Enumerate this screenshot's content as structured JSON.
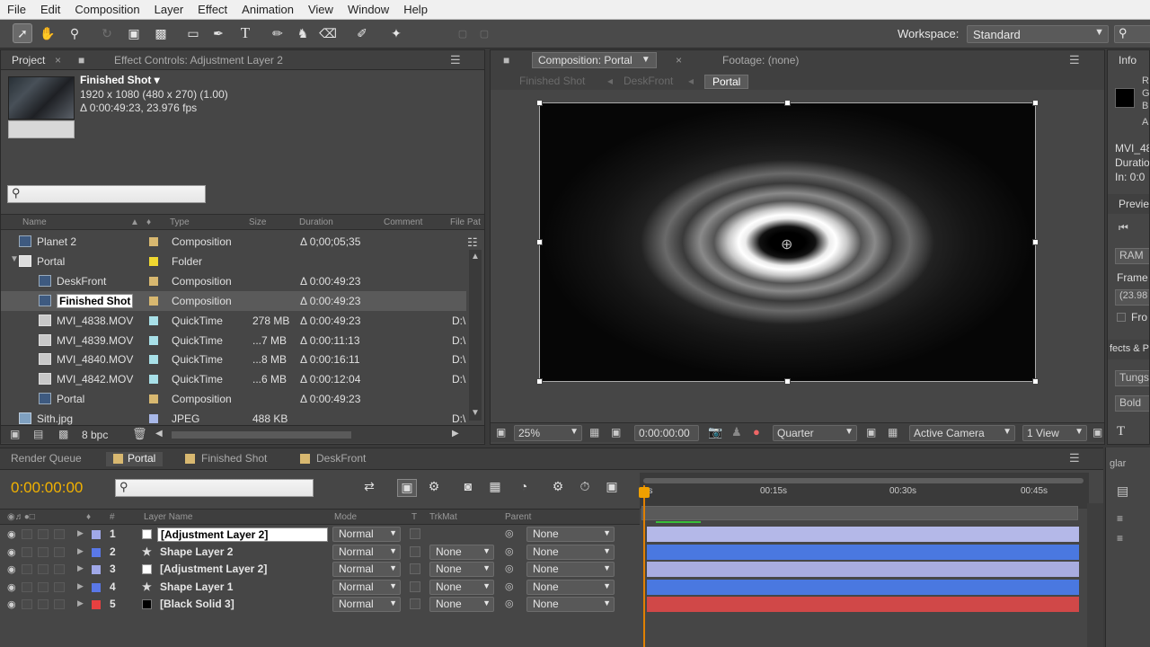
{
  "menu": [
    "File",
    "Edit",
    "Composition",
    "Layer",
    "Effect",
    "Animation",
    "View",
    "Window",
    "Help"
  ],
  "toolbar": {
    "tools": [
      "selection",
      "hand",
      "zoom",
      "rotate",
      "camera-orbit",
      "pan-behind",
      "rectangle-mask",
      "pen",
      "type",
      "brush",
      "clone-stamp",
      "eraser",
      "roto-brush",
      "puppet-pin"
    ],
    "workspace_label": "Workspace:",
    "workspace_value": "Standard",
    "search_icon": "search-icon"
  },
  "project": {
    "tab_project": "Project",
    "tab_effect_controls": "Effect Controls: Adjustment Layer 2",
    "info_title": "Finished Shot ▾",
    "info_dims": "1920 x 1080  (480 x 270) (1.00)",
    "info_duration": "Δ 0:00:49:23, 23.976 fps",
    "columns": {
      "name": "Name",
      "type": "Type",
      "size": "Size",
      "duration": "Duration",
      "comment": "Comment",
      "file_path": "File Pat"
    },
    "rows": [
      {
        "name": "Planet 2",
        "type": "Composition",
        "size": "",
        "duration": "Δ 0;00;05;35",
        "path": "",
        "label_color": "#d8b870",
        "icon": "comp",
        "indent": 0,
        "selected": false,
        "twirl": ""
      },
      {
        "name": "Portal",
        "type": "Folder",
        "size": "",
        "duration": "",
        "path": "",
        "label_color": "#f0d830",
        "icon": "folder",
        "indent": 0,
        "selected": false,
        "twirl": "▼"
      },
      {
        "name": "DeskFront",
        "type": "Composition",
        "size": "",
        "duration": "Δ 0:00:49:23",
        "path": "",
        "label_color": "#d8b870",
        "icon": "comp",
        "indent": 1,
        "selected": false,
        "twirl": ""
      },
      {
        "name": "Finished Shot",
        "type": "Composition",
        "size": "",
        "duration": "Δ 0:00:49:23",
        "path": "",
        "label_color": "#d8b870",
        "icon": "comp",
        "indent": 1,
        "selected": true,
        "twirl": ""
      },
      {
        "name": "MVI_4838.MOV",
        "type": "QuickTime",
        "size": "278 MB",
        "duration": "Δ 0:00:49:23",
        "path": "D:\\",
        "label_color": "#a8e0e8",
        "icon": "mov",
        "indent": 1,
        "selected": false,
        "twirl": ""
      },
      {
        "name": "MVI_4839.MOV",
        "type": "QuickTime",
        "size": "...7 MB",
        "duration": "Δ 0:00:11:13",
        "path": "D:\\",
        "label_color": "#a8e0e8",
        "icon": "mov",
        "indent": 1,
        "selected": false,
        "twirl": ""
      },
      {
        "name": "MVI_4840.MOV",
        "type": "QuickTime",
        "size": "...8 MB",
        "duration": "Δ 0:00:16:11",
        "path": "D:\\",
        "label_color": "#a8e0e8",
        "icon": "mov",
        "indent": 1,
        "selected": false,
        "twirl": ""
      },
      {
        "name": "MVI_4842.MOV",
        "type": "QuickTime",
        "size": "...6 MB",
        "duration": "Δ 0:00:12:04",
        "path": "D:\\",
        "label_color": "#a8e0e8",
        "icon": "mov",
        "indent": 1,
        "selected": false,
        "twirl": ""
      },
      {
        "name": "Portal",
        "type": "Composition",
        "size": "",
        "duration": "Δ 0:00:49:23",
        "path": "",
        "label_color": "#d8b870",
        "icon": "comp",
        "indent": 1,
        "selected": false,
        "twirl": ""
      },
      {
        "name": "Sith.jpg",
        "type": "JPEG",
        "size": "488 KB",
        "duration": "",
        "path": "D:\\",
        "label_color": "#a8b8e8",
        "icon": "img",
        "indent": 0,
        "selected": false,
        "twirl": ""
      }
    ],
    "bpc": "8 bpc"
  },
  "composition": {
    "tab": "Composition: Portal",
    "footage_tab": "Footage: (none)",
    "breadcrumbs": [
      "Finished Shot",
      "DeskFront",
      "Portal"
    ],
    "zoom": "25%",
    "timecode": "0:00:00:00",
    "resolution": "Quarter",
    "camera": "Active Camera",
    "views": "1 View"
  },
  "info_panel": {
    "tab": "Info",
    "rgba": [
      "R",
      "G",
      "B",
      "A"
    ],
    "file": "MVI_48",
    "duration": "Duratio",
    "in": "In: 0:0",
    "preview_tab": "Previe",
    "ram": "RAM",
    "frame_rate_label": "Frame",
    "frame_rate_value": "(23.98",
    "from": "Fro",
    "effects_tab": "fects & P",
    "font": "Tungs",
    "style": "Bold"
  },
  "timeline": {
    "tabs": [
      "Render Queue",
      "Portal",
      "Finished Shot",
      "DeskFront"
    ],
    "active_tab": "Portal",
    "timecode": "0:00:00:00",
    "columns": {
      "layer_name": "Layer Name",
      "mode": "Mode",
      "t": "T",
      "trkmat": "TrkMat",
      "parent": "Parent"
    },
    "ruler": [
      "0s",
      "00:15s",
      "00:30s",
      "00:45s"
    ],
    "layers": [
      {
        "num": "1",
        "name": "[Adjustment Layer 2]",
        "mode": "Normal",
        "trkmat": "",
        "parent": "None",
        "label_color": "#a0a8e8",
        "src": "white",
        "bar_color": "#b4b8e8",
        "editing": true
      },
      {
        "num": "2",
        "name": "Shape Layer 2",
        "mode": "Normal",
        "trkmat": "None",
        "parent": "None",
        "label_color": "#5a78e8",
        "src": "star",
        "bar_color": "#4a78e0",
        "editing": false
      },
      {
        "num": "3",
        "name": "[Adjustment Layer 2]",
        "mode": "Normal",
        "trkmat": "None",
        "parent": "None",
        "label_color": "#a0a8e8",
        "src": "white",
        "bar_color": "#a8ace0",
        "editing": false
      },
      {
        "num": "4",
        "name": "Shape Layer 1",
        "mode": "Normal",
        "trkmat": "None",
        "parent": "None",
        "label_color": "#5a78e8",
        "src": "star",
        "bar_color": "#4a78e0",
        "editing": false
      },
      {
        "num": "5",
        "name": "[Black Solid 3]",
        "mode": "Normal",
        "trkmat": "None",
        "parent": "None",
        "label_color": "#e84040",
        "src": "black",
        "bar_color": "#d04848",
        "editing": false
      }
    ]
  }
}
